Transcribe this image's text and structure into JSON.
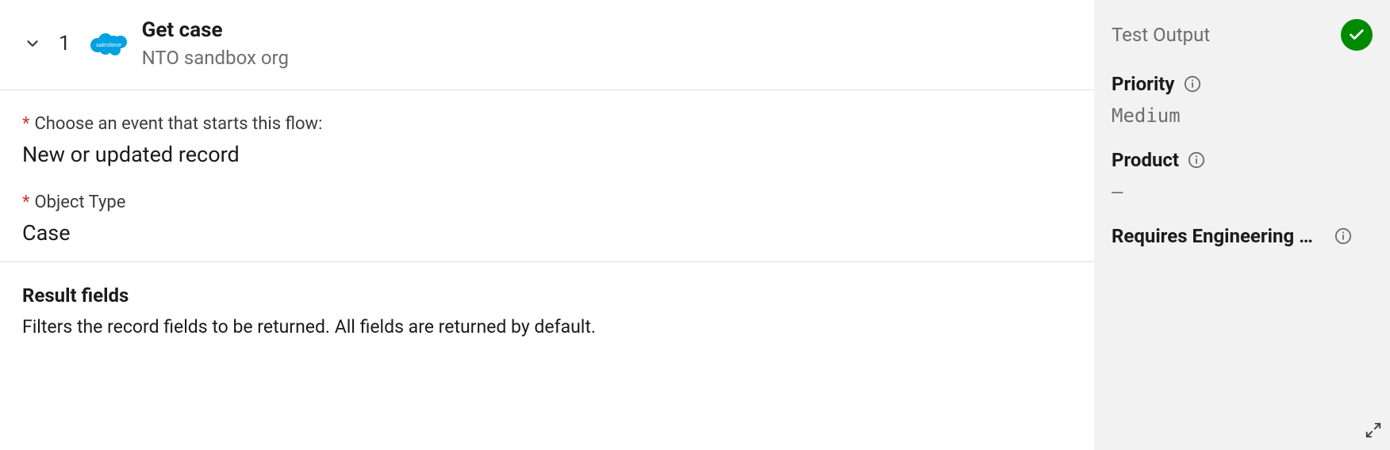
{
  "step": {
    "number": "1",
    "title": "Get case",
    "subtitle": "NTO sandbox org",
    "connector_icon": "salesforce-cloud-icon"
  },
  "config": {
    "event_label": "Choose an event that starts this flow:",
    "event_value": "New or updated record",
    "object_type_label": "Object Type",
    "object_type_value": "Case"
  },
  "result_fields": {
    "heading": "Result fields",
    "description": "Filters the record fields to be returned. All fields are returned by default."
  },
  "test_output": {
    "header": "Test Output",
    "status": "success",
    "items": [
      {
        "label": "Priority",
        "value": "Medium"
      },
      {
        "label": "Product",
        "value": "–"
      },
      {
        "label": "Requires Engineering A...",
        "value": ""
      }
    ]
  }
}
